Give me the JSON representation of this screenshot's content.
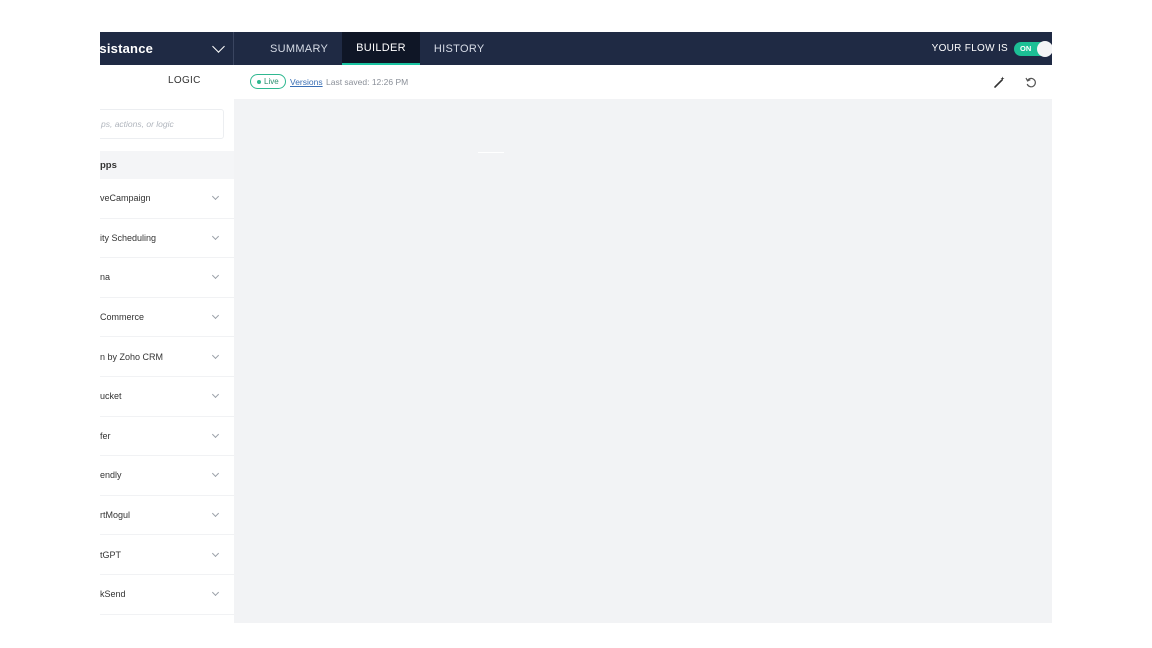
{
  "topbar": {
    "flow_name": "ssistance",
    "tabs": [
      {
        "label": "SUMMARY",
        "active": false
      },
      {
        "label": "BUILDER",
        "active": true
      },
      {
        "label": "HISTORY",
        "active": false
      }
    ],
    "flow_status_label": "YOUR FLOW IS",
    "toggle_label": "ON"
  },
  "subbar": {
    "logic_label": "LOGIC",
    "live_badge": "Live",
    "versions_link": "Versions",
    "last_saved": "Last saved: 12:26 PM"
  },
  "sidebar": {
    "search_placeholder": "ps, actions, or logic",
    "apps_header": "pps",
    "apps": [
      {
        "label": "veCampaign"
      },
      {
        "label": "ity Scheduling"
      },
      {
        "label": "na"
      },
      {
        "label": "Commerce"
      },
      {
        "label": "n by Zoho CRM"
      },
      {
        "label": "ucket"
      },
      {
        "label": "fer"
      },
      {
        "label": "endly"
      },
      {
        "label": "rtMogul"
      },
      {
        "label": "tGPT"
      },
      {
        "label": "kSend"
      }
    ]
  },
  "colors": {
    "topbar_bg": "#1f2a44",
    "active_tab_accent": "#19c2a0",
    "toggle_on": "#1cbf95",
    "canvas_bg": "#f2f3f5"
  },
  "icons": {
    "flow_dropdown": "chevron-down-icon",
    "magic": "magic-wand-icon",
    "undo": "undo-icon",
    "app_expand": "chevron-down-icon"
  }
}
